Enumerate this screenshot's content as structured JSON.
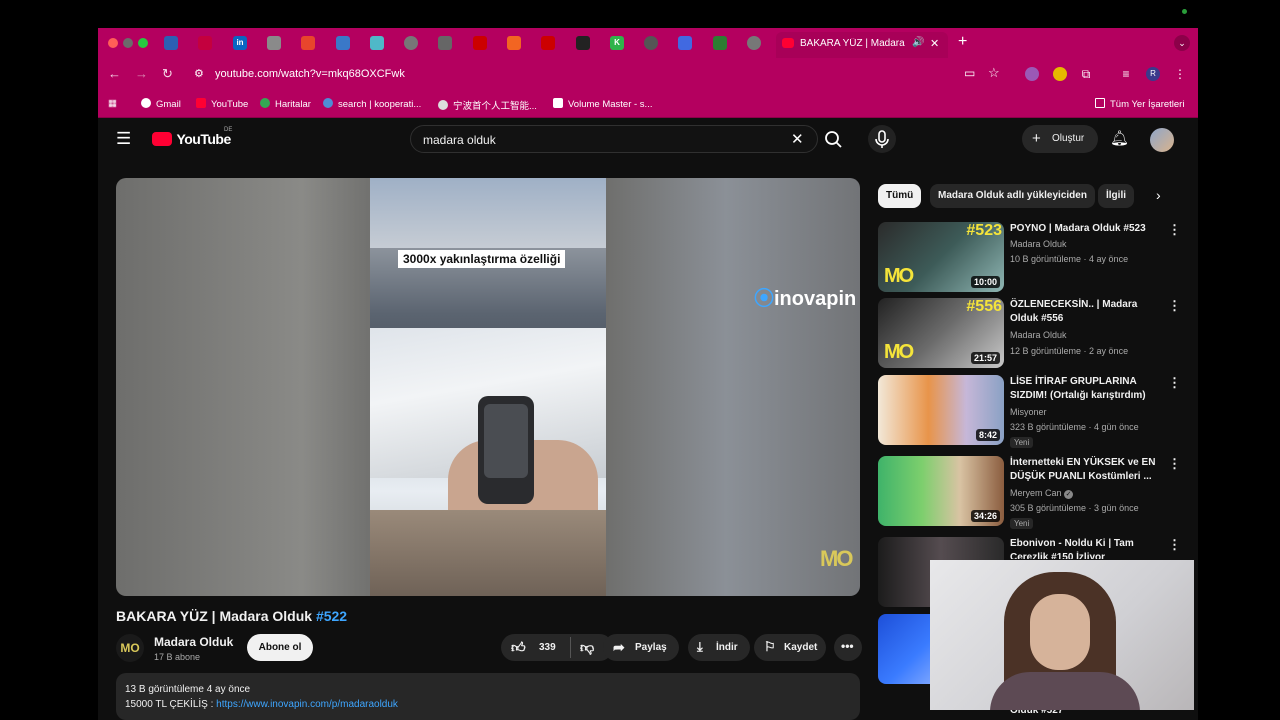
{
  "browser": {
    "tab_title": "BAKARA YÜZ | Madara Ol",
    "url": "youtube.com/watch?v=mkq68OXCFwk",
    "profile_initial": "R"
  },
  "bookmarks": [
    "Gmail",
    "YouTube",
    "Haritalar",
    "search | kooperati...",
    "宁波首个人工智能...",
    "Volume Master - s...",
    "Tüm Yer İşaretleri"
  ],
  "youtube": {
    "logo_text": "YouTube",
    "region": "DE",
    "search_query": "madara olduk",
    "create_label": "Oluştur"
  },
  "video": {
    "caption": "3000x yakınlaştırma özelliği",
    "brand_overlay": "inovapin",
    "watermark": "MO",
    "title_main": "BAKARA YÜZ | Madara Olduk ",
    "title_tag": "#522",
    "channel_name": "Madara Olduk",
    "channel_subs": "17 B abone",
    "channel_avatar": "MO",
    "subscribe_label": "Abone ol",
    "likes": "339",
    "share_label": "Paylaş",
    "download_label": "İndir",
    "save_label": "Kaydet",
    "views_date": "13 B görüntüleme  4 ay önce",
    "desc_prefix": "15000 TL ÇEKİLİŞ : ",
    "desc_link": "https://www.inovapin.com/p/madaraolduk"
  },
  "chips": [
    "Tümü",
    "Madara Olduk adlı yükleyiciden",
    "İlgili"
  ],
  "recommendations": [
    {
      "title": "POYNO | Madara Olduk #523",
      "channel": "Madara Olduk",
      "meta": "10 B görüntüleme  ·  4 ay önce",
      "duration": "10:00",
      "badge": "#523"
    },
    {
      "title": "ÖZLENECEKSİN.. | Madara Olduk #556",
      "channel": "Madara Olduk",
      "meta": "12 B görüntüleme  ·  2 ay önce",
      "duration": "21:57",
      "badge": "#556"
    },
    {
      "title": "LİSE İTİRAF GRUPLARINA SIZDIM! (Ortalığı karıştırdım)",
      "channel": "Misyoner",
      "meta": "323 B görüntüleme  ·  4 gün önce",
      "duration": "8:42",
      "new": "Yeni"
    },
    {
      "title": "İnternetteki EN YÜKSEK  ve EN DÜŞÜK PUANLI Kostümleri ...",
      "channel": "Meryem Can",
      "meta": "305 B görüntüleme  ·  3 gün önce",
      "duration": "34:26",
      "new": "Yeni"
    },
    {
      "title": "Ebonivon - Noldu Ki | Tam Cerezlik #150 İzliyor",
      "channel": "",
      "meta": "",
      "duration": ""
    },
    {
      "title": "Olduk #527",
      "channel": "",
      "meta": "",
      "duration": ""
    }
  ],
  "colors": {
    "chrome": "#b4005f",
    "yt_bg": "#0f0f0f",
    "link": "#3ea6ff"
  }
}
